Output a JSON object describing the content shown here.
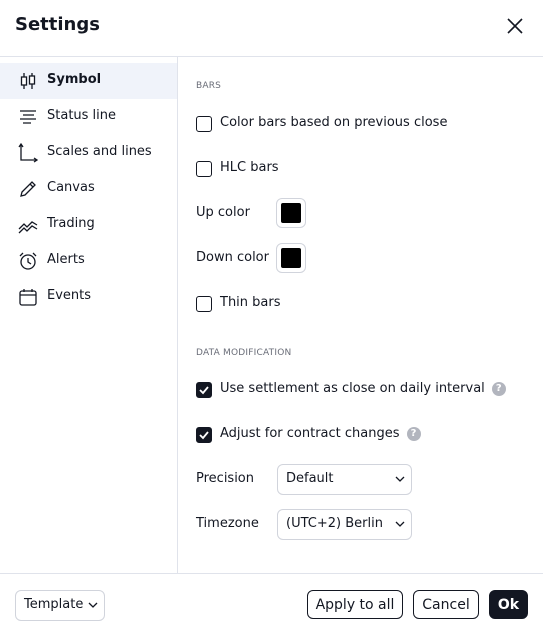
{
  "dialog": {
    "title": "Settings"
  },
  "sidebar": {
    "items": [
      {
        "label": "Symbol",
        "icon": "candles-icon",
        "active": true
      },
      {
        "label": "Status line",
        "icon": "status-line-icon"
      },
      {
        "label": "Scales and lines",
        "icon": "scales-icon"
      },
      {
        "label": "Canvas",
        "icon": "pencil-icon"
      },
      {
        "label": "Trading",
        "icon": "trading-icon"
      },
      {
        "label": "Alerts",
        "icon": "alarm-clock-icon"
      },
      {
        "label": "Events",
        "icon": "calendar-icon"
      }
    ]
  },
  "content": {
    "bars_section": "BARS",
    "color_bars_label": "Color bars based on previous close",
    "hlc_bars_label": "HLC bars",
    "up_color_label": "Up color",
    "up_color": "#000000",
    "down_color_label": "Down color",
    "down_color": "#000000",
    "thin_bars_label": "Thin bars",
    "data_section": "DATA MODIFICATION",
    "settlement_label": "Use settlement as close on daily interval",
    "contract_label": "Adjust for contract changes",
    "precision_label": "Precision",
    "precision_value": "Default",
    "timezone_label": "Timezone",
    "timezone_value": "(UTC+2) Berlin",
    "help_glyph": "?"
  },
  "footer": {
    "template_label": "Template",
    "apply_all_label": "Apply to all",
    "cancel_label": "Cancel",
    "ok_label": "Ok"
  }
}
